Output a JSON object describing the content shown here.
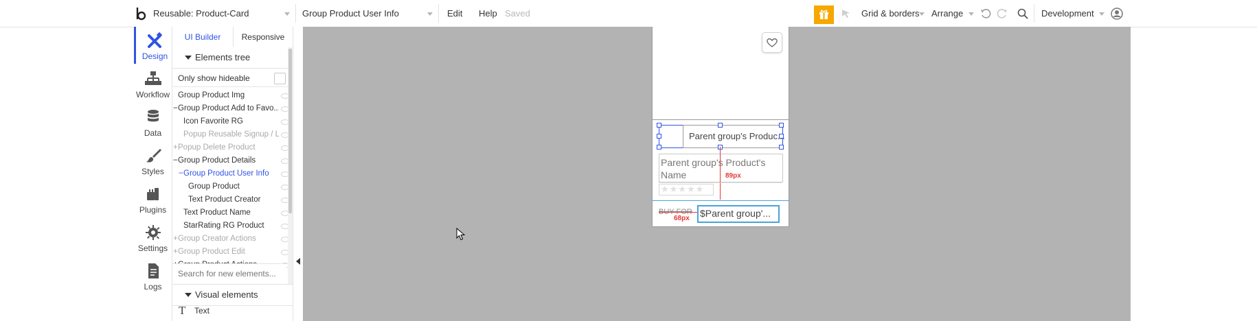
{
  "topbar": {
    "page_selector": "Reusable: Product-Card",
    "element_selector": "Group Product User Info",
    "menu_edit": "Edit",
    "menu_help": "Help",
    "save_status": "Saved",
    "grid_borders": "Grid & borders",
    "arrange": "Arrange",
    "environment": "Development"
  },
  "nav": [
    {
      "label": "Design"
    },
    {
      "label": "Workflow"
    },
    {
      "label": "Data"
    },
    {
      "label": "Styles"
    },
    {
      "label": "Plugins"
    },
    {
      "label": "Settings"
    },
    {
      "label": "Logs"
    }
  ],
  "panel": {
    "tab_ui_builder": "UI Builder",
    "tab_responsive": "Responsive",
    "elements_tree_title": "Elements tree",
    "only_show_hideable": "Only show hideable",
    "tree": [
      {
        "label": "Group Product Img",
        "prefix": ""
      },
      {
        "label": "Group Product Add to Favo...",
        "prefix": "−"
      },
      {
        "label": "Icon Favorite RG",
        "prefix": ""
      },
      {
        "label": "Popup Reusable Signup / L...",
        "prefix": ""
      },
      {
        "label": "Popup Delete Product",
        "prefix": "+"
      },
      {
        "label": "Group Product Details",
        "prefix": "−"
      },
      {
        "label": "Group Product User Info",
        "prefix": "−"
      },
      {
        "label": "Group Product",
        "prefix": ""
      },
      {
        "label": "Text Product Creator",
        "prefix": ""
      },
      {
        "label": "Text Product Name",
        "prefix": ""
      },
      {
        "label": "StarRating RG Product",
        "prefix": ""
      },
      {
        "label": "Group Creator Actions",
        "prefix": "+"
      },
      {
        "label": "Group Product Edit",
        "prefix": "+"
      },
      {
        "label": "Group Product Actions",
        "prefix": "+"
      }
    ],
    "search_placeholder": "Search for new elements...",
    "visual_elements_title": "Visual elements",
    "visual_text_label": "Text"
  },
  "card": {
    "creator_text": "Parent group's Produc...",
    "name_text": "Parent group's Product's Name",
    "buy_text": "BUY FOR",
    "price_text": "$Parent group'...",
    "dim_vertical": "89px",
    "dim_horizontal": "68px"
  },
  "colors": {
    "accent": "#2f53e5",
    "canvas_bg": "#b3b3b3",
    "gift_bg": "#f6a800",
    "measure_red": "#e53935"
  }
}
